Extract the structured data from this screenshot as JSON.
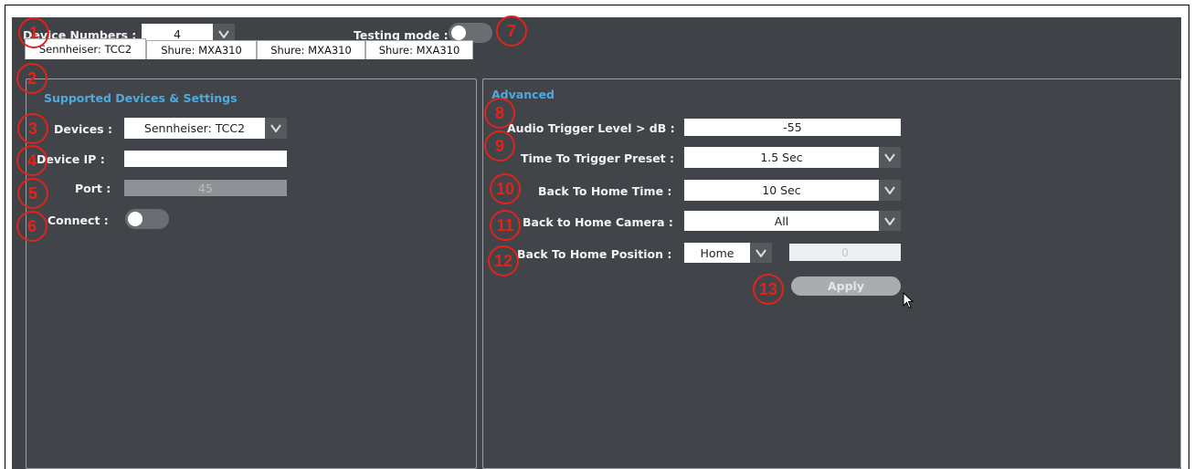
{
  "header": {
    "device_numbers_label": "Device Numbers :",
    "device_numbers_value": "4",
    "testing_mode_label": "Testing mode :",
    "testing_mode_on": false
  },
  "tabs": [
    {
      "label": "Sennheiser: TCC2",
      "active": true
    },
    {
      "label": "Shure: MXA310",
      "active": false
    },
    {
      "label": "Shure: MXA310",
      "active": false
    },
    {
      "label": "Shure: MXA310",
      "active": false
    }
  ],
  "left_panel": {
    "title": "Supported Devices & Settings",
    "devices_label": "Devices :",
    "devices_value": "Sennheiser: TCC2",
    "device_ip_label": "Device IP :",
    "device_ip_value": "",
    "port_label": "Port :",
    "port_value": "45",
    "connect_label": "Connect :",
    "connect_on": false
  },
  "right_panel": {
    "title": "Advanced",
    "audio_trigger_label": "Audio Trigger Level > dB :",
    "audio_trigger_value": "-55",
    "time_to_trigger_label": "Time To Trigger Preset :",
    "time_to_trigger_value": "1.5 Sec",
    "back_home_time_label": "Back To Home Time :",
    "back_home_time_value": "10 Sec",
    "back_home_camera_label": "Back to Home Camera :",
    "back_home_camera_value": "All",
    "back_home_position_label": "Back To Home Position :",
    "back_home_position_value": "Home",
    "back_home_position_number": "0",
    "apply_label": "Apply"
  },
  "markers": [
    "1",
    "2",
    "3",
    "4",
    "5",
    "6",
    "7",
    "8",
    "9",
    "10",
    "11",
    "12",
    "13"
  ],
  "colors": {
    "background": "#3f4347",
    "accent": "#4fa9df",
    "marker": "#e2231a"
  }
}
